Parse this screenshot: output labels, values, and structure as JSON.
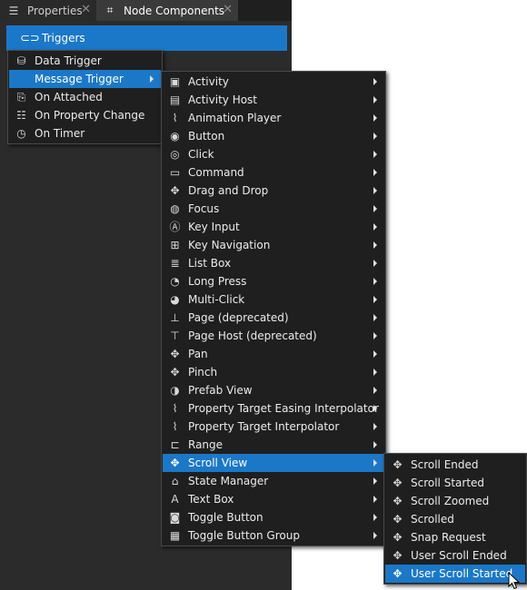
{
  "tabs": [
    {
      "label": "Properties",
      "icon": "list-icon",
      "glyph": "☰",
      "close": "✕"
    },
    {
      "label": "Node Components",
      "icon": "components-icon",
      "glyph": "⌗",
      "close": "✕"
    }
  ],
  "triggers_row": {
    "label": "Triggers",
    "icon": "link-icon",
    "glyph": "⊂⊃"
  },
  "menu1": [
    {
      "label": "Data Trigger",
      "icon": "database-icon",
      "glyph": "⛁"
    },
    {
      "label": "Message Trigger",
      "icon": "",
      "glyph": "",
      "highlighted": true,
      "submenu": true
    },
    {
      "label": "On Attached",
      "icon": "attach-icon",
      "glyph": "⎘"
    },
    {
      "label": "On Property Change",
      "icon": "property-list-icon",
      "glyph": "☷"
    },
    {
      "label": "On Timer",
      "icon": "timer-icon",
      "glyph": "◷"
    }
  ],
  "menu2": [
    {
      "label": "Activity",
      "icon": "activity-icon",
      "glyph": "▣"
    },
    {
      "label": "Activity Host",
      "icon": "activity-host-icon",
      "glyph": "▤"
    },
    {
      "label": "Animation Player",
      "icon": "animation-icon",
      "glyph": "⌇"
    },
    {
      "label": "Button",
      "icon": "button-icon",
      "glyph": "◉"
    },
    {
      "label": "Click",
      "icon": "click-icon",
      "glyph": "◎"
    },
    {
      "label": "Command",
      "icon": "command-icon",
      "glyph": "▭"
    },
    {
      "label": "Drag and Drop",
      "icon": "drag-icon",
      "glyph": "✥"
    },
    {
      "label": "Focus",
      "icon": "focus-icon",
      "glyph": "◍"
    },
    {
      "label": "Key Input",
      "icon": "key-input-icon",
      "glyph": "Ⓐ"
    },
    {
      "label": "Key Navigation",
      "icon": "key-navigation-icon",
      "glyph": "⊞"
    },
    {
      "label": "List Box",
      "icon": "list-box-icon",
      "glyph": "≣"
    },
    {
      "label": "Long Press",
      "icon": "long-press-icon",
      "glyph": "◔"
    },
    {
      "label": "Multi-Click",
      "icon": "multi-click-icon",
      "glyph": "◕"
    },
    {
      "label": "Page (deprecated)",
      "icon": "page-icon",
      "glyph": "⊥"
    },
    {
      "label": "Page Host (deprecated)",
      "icon": "page-host-icon",
      "glyph": "⊤"
    },
    {
      "label": "Pan",
      "icon": "pan-icon",
      "glyph": "✥"
    },
    {
      "label": "Pinch",
      "icon": "pinch-icon",
      "glyph": "✥"
    },
    {
      "label": "Prefab View",
      "icon": "prefab-icon",
      "glyph": "◑"
    },
    {
      "label": "Property Target Easing Interpolator",
      "icon": "easing-icon",
      "glyph": "⌇"
    },
    {
      "label": "Property Target Interpolator",
      "icon": "interpolator-icon",
      "glyph": "⌇"
    },
    {
      "label": "Range",
      "icon": "range-icon",
      "glyph": "⊏"
    },
    {
      "label": "Scroll View",
      "icon": "scroll-view-icon",
      "glyph": "✥",
      "highlighted": true
    },
    {
      "label": "State Manager",
      "icon": "state-manager-icon",
      "glyph": "⌂"
    },
    {
      "label": "Text Box",
      "icon": "text-box-icon",
      "glyph": "A"
    },
    {
      "label": "Toggle Button",
      "icon": "toggle-button-icon",
      "glyph": "◙"
    },
    {
      "label": "Toggle Button Group",
      "icon": "toggle-group-icon",
      "glyph": "▦"
    }
  ],
  "menu3": [
    {
      "label": "Scroll Ended",
      "icon": "scroll-icon",
      "glyph": "✥"
    },
    {
      "label": "Scroll Started",
      "icon": "scroll-icon",
      "glyph": "✥"
    },
    {
      "label": "Scroll Zoomed",
      "icon": "scroll-icon",
      "glyph": "✥"
    },
    {
      "label": "Scrolled",
      "icon": "scroll-icon",
      "glyph": "✥"
    },
    {
      "label": "Snap Request",
      "icon": "scroll-icon",
      "glyph": "✥"
    },
    {
      "label": "User Scroll Ended",
      "icon": "scroll-icon",
      "glyph": "✥"
    },
    {
      "label": "User Scroll Started",
      "icon": "scroll-icon",
      "glyph": "✥",
      "highlighted": true
    }
  ],
  "colors": {
    "accent": "#1b78c8",
    "menu_bg": "#1f1f1f",
    "panel_bg": "#2b2b2b"
  }
}
